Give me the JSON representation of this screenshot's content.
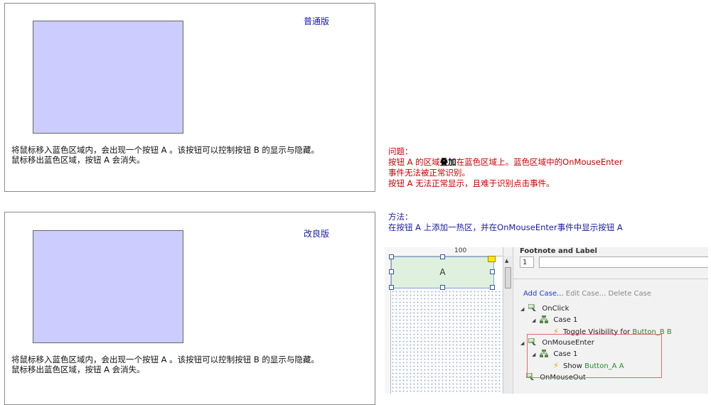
{
  "panel_normal": {
    "title": "普通版",
    "desc_line1": "将鼠标移入蓝色区域内，会出现一个按钮 A 。该按钮可以控制按钮 B 的显示与隐藏。",
    "desc_line2": "鼠标移出蓝色区域，按钮 A 会消失。"
  },
  "panel_improved": {
    "title": "改良版",
    "desc_line1": "将鼠标移入蓝色区域内，会出现一个按钮 A 。该按钮可以控制按钮 B 的显示与隐藏。",
    "desc_line2": "鼠标移出蓝色区域，按钮 A 会消失。"
  },
  "problem": {
    "heading": "问题：",
    "line1_a": "按钮 A 的区域",
    "line1_bold": "叠加",
    "line1_b": "在蓝色区域上。蓝色区域中的OnMouseEnter",
    "line2": "事件无法被正常识别。",
    "line3": "按钮 A 无法正常显示，且难于识别点击事件。"
  },
  "method": {
    "heading": "方法：",
    "line1": "在按钮 A 上添加一热区，并在OnMouseEnter事件中显示按钮 A"
  },
  "editor": {
    "ruler_label": "100",
    "button_label": "A",
    "props_heading": "Footnote and Label",
    "footnote_value": "1",
    "add_case": "Add Case...",
    "edit_case": "Edit Case...",
    "delete_case": "Delete Case",
    "events": {
      "onclick": "OnClick",
      "case1_a": "Case 1",
      "action1_prefix": "Toggle Visibility for ",
      "action1_target": "Button_B B",
      "onmouseenter": "OnMouseEnter",
      "case1_b": "Case 1",
      "action2_prefix": "Show ",
      "action2_target": "Button_A A",
      "onmouseout": "OnMouseOut"
    }
  },
  "colors": {
    "blue_area": "#ccccff",
    "title_blue": "#1a1aa6",
    "problem_red": "#cc0000",
    "highlight_box": "#e06a6a"
  }
}
